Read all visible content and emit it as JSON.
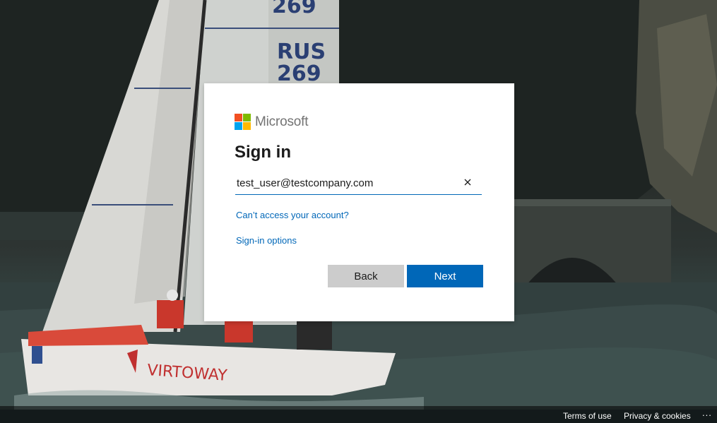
{
  "brand": {
    "name": "Microsoft",
    "colors": [
      "#f25022",
      "#7fba00",
      "#00a4ef",
      "#ffb900"
    ]
  },
  "signin": {
    "title": "Sign in",
    "email_value": "test_user@testcompany.com",
    "clear_icon": "close-icon",
    "cant_access_link": "Can’t access your account?",
    "signin_options_link": "Sign-in options",
    "back_label": "Back",
    "next_label": "Next",
    "accent_color": "#0067b8"
  },
  "background": {
    "sail_number_top": "269",
    "sail_country": "RUS",
    "sail_number": "269",
    "hull_text": "VIRTOWAY"
  },
  "footer": {
    "terms": "Terms of use",
    "privacy": "Privacy & cookies",
    "more": "..."
  }
}
